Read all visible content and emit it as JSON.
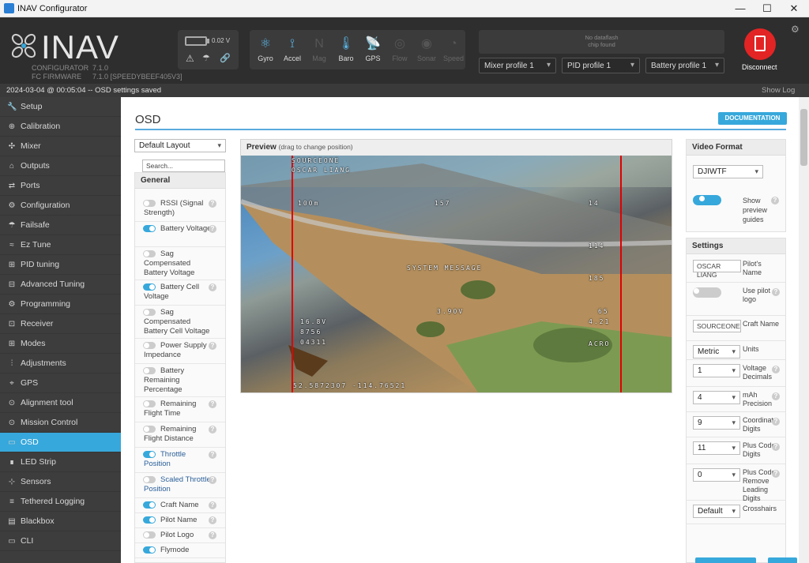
{
  "window": {
    "title": "INAV Configurator",
    "minimize": "—",
    "maximize": "☐",
    "close": "✕"
  },
  "header": {
    "logo": "INAV",
    "configurator_label": "CONFIGURATOR",
    "configurator_version": "7.1.0",
    "firmware_label": "FC FIRMWARE",
    "firmware_version": "7.1.0 [SPEEDYBEEF405V3]",
    "battery_voltage": "0.02 V",
    "sensors": [
      {
        "label": "Gyro",
        "icon": "gyro-icon",
        "active": true
      },
      {
        "label": "Accel",
        "icon": "accel-icon",
        "active": true
      },
      {
        "label": "Mag",
        "icon": "mag-icon",
        "active": false
      },
      {
        "label": "Baro",
        "icon": "baro-icon",
        "active": true
      },
      {
        "label": "GPS",
        "icon": "gps-icon",
        "active": true
      },
      {
        "label": "Flow",
        "icon": "flow-icon",
        "active": false
      },
      {
        "label": "Sonar",
        "icon": "sonar-icon",
        "active": false
      },
      {
        "label": "Speed",
        "icon": "speed-icon",
        "active": false
      }
    ],
    "dataflash": "No dataflash\nchip found",
    "mixer_profile": "Mixer profile 1",
    "pid_profile": "PID profile 1",
    "battery_profile": "Battery profile 1",
    "disconnect": "Disconnect",
    "accent": "#e32424"
  },
  "status": {
    "message": "2024-03-04 @ 00:05:04 -- OSD settings saved",
    "show_log": "Show Log"
  },
  "sidebar": [
    {
      "label": "Setup",
      "icon": "wrench-icon"
    },
    {
      "label": "Calibration",
      "icon": "calibration-icon"
    },
    {
      "label": "Mixer",
      "icon": "mixer-icon"
    },
    {
      "label": "Outputs",
      "icon": "outputs-icon"
    },
    {
      "label": "Ports",
      "icon": "ports-icon"
    },
    {
      "label": "Configuration",
      "icon": "gear-icon"
    },
    {
      "label": "Failsafe",
      "icon": "failsafe-icon"
    },
    {
      "label": "Ez Tune",
      "icon": "eztune-icon"
    },
    {
      "label": "PID tuning",
      "icon": "pid-icon"
    },
    {
      "label": "Advanced Tuning",
      "icon": "advanced-tuning-icon"
    },
    {
      "label": "Programming",
      "icon": "programming-icon"
    },
    {
      "label": "Receiver",
      "icon": "receiver-icon"
    },
    {
      "label": "Modes",
      "icon": "modes-icon"
    },
    {
      "label": "Adjustments",
      "icon": "adjustments-icon"
    },
    {
      "label": "GPS",
      "icon": "gps-icon"
    },
    {
      "label": "Alignment tool",
      "icon": "alignment-icon"
    },
    {
      "label": "Mission Control",
      "icon": "mission-icon"
    },
    {
      "label": "OSD",
      "icon": "osd-icon",
      "active": true
    },
    {
      "label": "LED Strip",
      "icon": "led-icon"
    },
    {
      "label": "Sensors",
      "icon": "sensors-icon"
    },
    {
      "label": "Tethered Logging",
      "icon": "tethered-icon"
    },
    {
      "label": "Blackbox",
      "icon": "blackbox-icon"
    },
    {
      "label": "CLI",
      "icon": "cli-icon"
    }
  ],
  "osd": {
    "title": "OSD",
    "documentation": "DOCUMENTATION",
    "layout": "Default Layout",
    "search_placeholder": "Search...",
    "group": "General",
    "elements": [
      {
        "label": "RSSI (Signal Strength)",
        "on": false,
        "help": true
      },
      {
        "label": "Battery Voltage",
        "on": true,
        "help": true
      },
      {
        "label": "Sag Compensated Battery Voltage",
        "on": false,
        "help": false
      },
      {
        "label": "Battery Cell Voltage",
        "on": true,
        "help": true
      },
      {
        "label": "Sag Compensated Battery Cell Voltage",
        "on": false,
        "help": false
      },
      {
        "label": "Power Supply Impedance",
        "on": false,
        "help": true
      },
      {
        "label": "Battery Remaining Percentage",
        "on": false,
        "help": false
      },
      {
        "label": "Remaining Flight Time",
        "on": false,
        "help": true
      },
      {
        "label": "Remaining Flight Distance",
        "on": false,
        "help": true
      },
      {
        "label": "Throttle Position",
        "on": true,
        "help": true,
        "link": true
      },
      {
        "label": "Scaled Throttle Position",
        "on": false,
        "help": true,
        "link": true
      },
      {
        "label": "Craft Name",
        "on": true,
        "help": true
      },
      {
        "label": "Pilot Name",
        "on": true,
        "help": true
      },
      {
        "label": "Pilot Logo",
        "on": false,
        "help": true
      },
      {
        "label": "Flymode",
        "on": true,
        "help": false
      }
    ],
    "preview_title": "Preview",
    "preview_hint": "(drag to change position)",
    "overlay": {
      "craft": "SOURCEONE",
      "pilot": "OSCAR LIANG",
      "alt": "100m",
      "home": "157",
      "sats": "14",
      "speed": "114",
      "msg": "SYSTEM MESSAGE",
      "heading": "185",
      "cell": "3.90V",
      "volt": "16.8V",
      "mah": "8756",
      "current": "04311",
      "ah": "4.21",
      "mode": "ACRO",
      "coords": "52.5872307  -114.76521",
      "r65": "65"
    },
    "video_format_title": "Video Format",
    "video_format": "DJIWTF",
    "show_guides": "Show preview guides",
    "settings_title": "Settings",
    "settings": [
      {
        "value": "OSCAR LIANG",
        "label": "Pilot's Name",
        "type": "text",
        "help": false
      },
      {
        "value": "",
        "label": "Use pilot logo",
        "type": "toggle",
        "help": true
      },
      {
        "value": "SOURCEONE",
        "label": "Craft Name",
        "type": "text",
        "help": false
      },
      {
        "value": "Metric",
        "label": "Units",
        "type": "select",
        "help": false
      },
      {
        "value": "1",
        "label": "Voltage Decimals",
        "type": "select",
        "help": true
      },
      {
        "value": "4",
        "label": "mAh Precision",
        "type": "select",
        "help": true
      },
      {
        "value": "9",
        "label": "Coordinate Digits",
        "type": "select",
        "help": true
      },
      {
        "value": "11",
        "label": "Plus Code Digits",
        "type": "select",
        "help": true
      },
      {
        "value": "0",
        "label": "Plus Code Remove Leading Digits",
        "type": "select",
        "help": true
      },
      {
        "value": "Default",
        "label": "Crosshairs",
        "type": "select",
        "help": false
      }
    ]
  }
}
